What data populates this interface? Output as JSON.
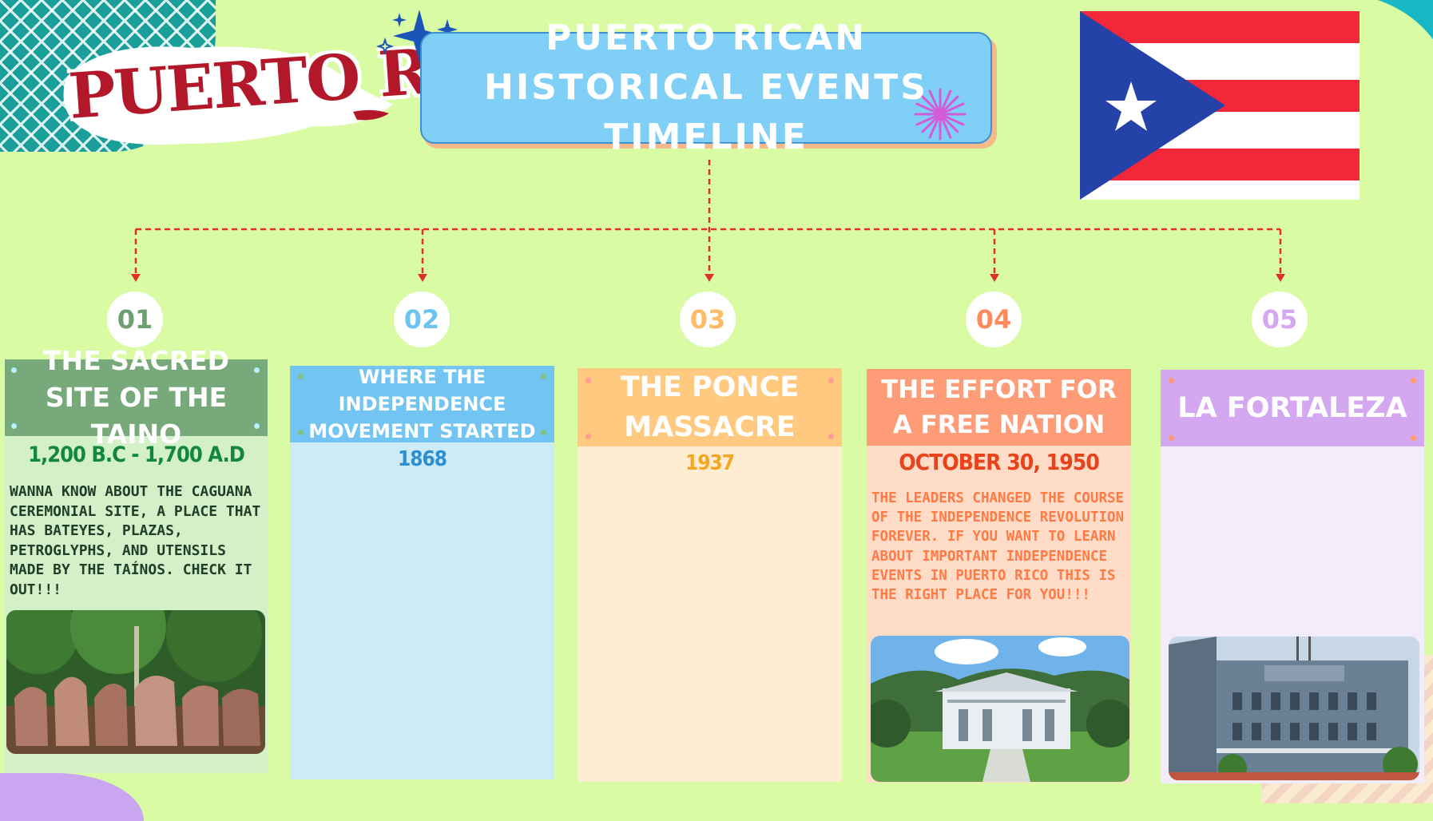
{
  "logo": {
    "text": "PUERTO RICO"
  },
  "header": {
    "title": "PUERTO RICAN HISTORICAL EVENTS TIMELINE"
  },
  "colors": {
    "background": "#d9fba3",
    "connector": "#e0302c",
    "card1": "#78a97b",
    "card2": "#72c4f2",
    "card3": "#ffca80",
    "card4": "#ff9c78",
    "card5": "#d4a8f0"
  },
  "events": [
    {
      "number": "01",
      "title": "THE SACRED SITE OF THE TAINO",
      "date": "1,200 B.C - 1,700 A.D",
      "description": "WANNA KNOW ABOUT THE CAGUANA CEREMONIAL SITE, A PLACE THAT HAS BATEYES, PLAZAS, PETROGLYPHS, AND UTENSILS MADE BY THE TAÍNOS. CHECK IT OUT!!!"
    },
    {
      "number": "02",
      "title": "WHERE THE INDEPENDENCE MOVEMENT STARTED",
      "date": "1868",
      "description": ""
    },
    {
      "number": "03",
      "title": "THE PONCE MASSACRE",
      "date": "1937",
      "description": ""
    },
    {
      "number": "04",
      "title": "THE EFFORT FOR A FREE NATION",
      "date": "OCTOBER 30, 1950",
      "description": "THE LEADERS CHANGED THE COURSE OF THE INDEPENDENCE REVOLUTION FOREVER. IF YOU WANT TO LEARN ABOUT IMPORTANT INDEPENDENCE EVENTS IN PUERTO RICO THIS IS THE RIGHT PLACE FOR YOU!!!"
    },
    {
      "number": "05",
      "title": "LA FORTALEZA",
      "date": "",
      "description": ""
    }
  ]
}
